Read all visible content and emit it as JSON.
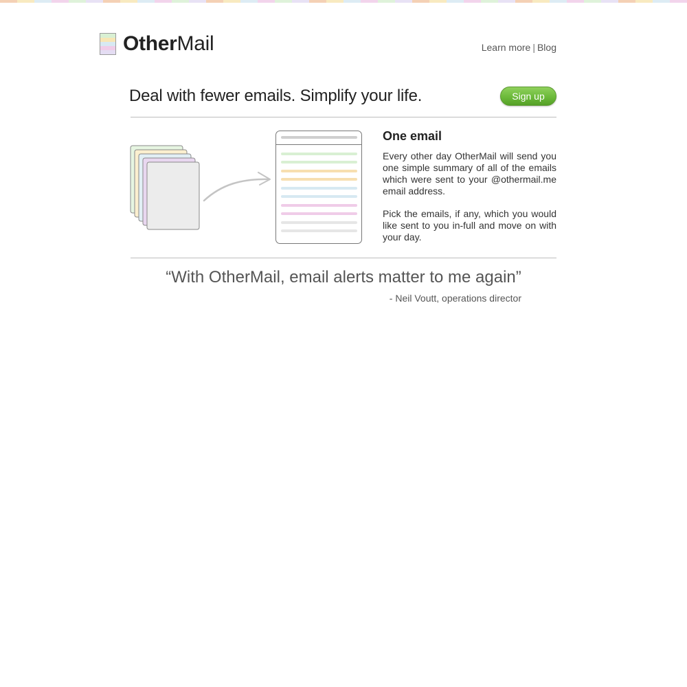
{
  "brand": {
    "name_bold": "Other",
    "name_light": "Mail"
  },
  "nav": {
    "learn_more": "Learn more",
    "separator": "|",
    "blog": "Blog"
  },
  "hero": {
    "tagline": "Deal with fewer emails. Simplify your life.",
    "signup_label": "Sign up"
  },
  "feature": {
    "title": "One email",
    "paragraph1": "Every other day OtherMail will send you one simple summary of all of the emails which were sent to your @othermail.me email address.",
    "paragraph2": "Pick the emails, if any, which you would like sent to you in-full and move on with your day."
  },
  "testimonial": {
    "quote": "“With OtherMail, email alerts matter to me again”",
    "attribution": "- Neil Voutt, operations director"
  },
  "colors": {
    "accent_green": "#6cba3a",
    "stripe": [
      "#d9f0d3",
      "#f7e6b5",
      "#d7e9f2",
      "#f0cce8",
      "#e4ddf3"
    ]
  },
  "icons": {
    "logo": "stacked-color-page-icon",
    "illustration": "many-emails-to-one-summary-illustration"
  }
}
